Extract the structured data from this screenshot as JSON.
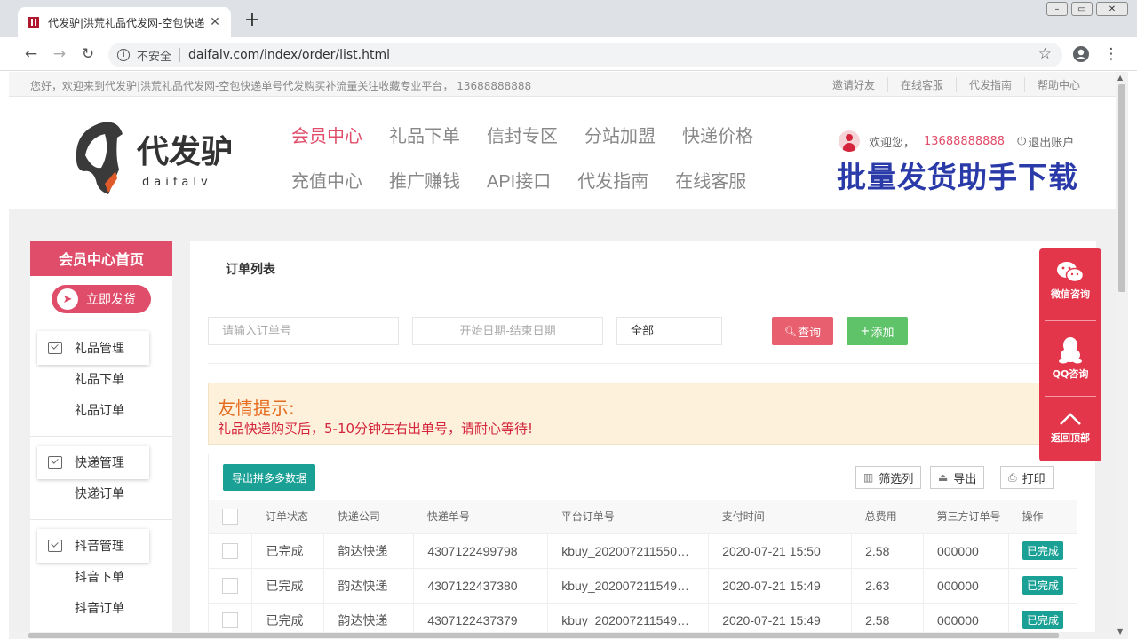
{
  "browser": {
    "tab_title": "代发驴|洪荒礼品代发网-空包快递",
    "insecure_label": "不安全",
    "url": "daifalv.com/index/order/list.html"
  },
  "topbar": {
    "welcome": "您好，欢迎来到代发驴|洪荒礼品代发网-空包快递单号代发购买补流量关注收藏专业平台， 13688888888",
    "links": [
      "邀请好友",
      "在线客服",
      "代发指南",
      "帮助中心"
    ]
  },
  "header": {
    "logo_text": "代发驴",
    "logo_sub": "daifalv",
    "nav_row1": [
      "会员中心",
      "礼品下单",
      "信封专区",
      "分站加盟",
      "快递价格"
    ],
    "nav_row2": [
      "充值中心",
      "推广赚钱",
      "API接口",
      "代发指南",
      "在线客服"
    ],
    "welcome_user": "欢迎您，",
    "phone": "13688888888",
    "logout": "退出账户",
    "batch_download": "批量发货助手下载"
  },
  "sidebar": {
    "home": "会员中心首页",
    "ship_now": "立即发货",
    "groups": [
      {
        "title": "礼品管理",
        "items": [
          "礼品下单",
          "礼品订单"
        ]
      },
      {
        "title": "快递管理",
        "items": [
          "快递订单"
        ]
      },
      {
        "title": "抖音管理",
        "items": [
          "抖音下单",
          "抖音订单"
        ]
      }
    ]
  },
  "main": {
    "title": "订单列表",
    "order_placeholder": "请输入订单号",
    "date_placeholder": "开始日期-结束日期",
    "status_select": "全部",
    "query": "查询",
    "add": "添加",
    "tip_title": "友情提示:",
    "tip_text": "礼品快递购买后，5-10分钟左右出单号，请耐心等待!",
    "export_pdd": "导出拼多多数据",
    "filter_cols": "筛选列",
    "export": "导出",
    "print": "打印",
    "columns": [
      "订单状态",
      "快递公司",
      "快递单号",
      "平台订单号",
      "支付时间",
      "总费用",
      "第三方订单号",
      "操作"
    ],
    "rows": [
      {
        "status": "已完成",
        "company": "韵达快递",
        "tracking": "4307122499798",
        "platform": "kbuy_202007211550…",
        "paid": "2020-07-21 15:50",
        "fee": "2.58",
        "third": "000000",
        "op": "已完成"
      },
      {
        "status": "已完成",
        "company": "韵达快递",
        "tracking": "4307122437380",
        "platform": "kbuy_202007211549…",
        "paid": "2020-07-21 15:49",
        "fee": "2.63",
        "third": "000000",
        "op": "已完成"
      },
      {
        "status": "已完成",
        "company": "韵达快递",
        "tracking": "4307122437379",
        "platform": "kbuy_202007211549…",
        "paid": "2020-07-21 15:49",
        "fee": "2.58",
        "third": "000000",
        "op": "已完成"
      }
    ]
  },
  "float_panel": {
    "wechat": "微信咨询",
    "qq": "QQ咨询",
    "top": "返回顶部"
  },
  "colors": {
    "accent": "#e04d6a",
    "teal": "#1aa094",
    "green": "#5fb878",
    "navy": "#2a3aa8"
  }
}
